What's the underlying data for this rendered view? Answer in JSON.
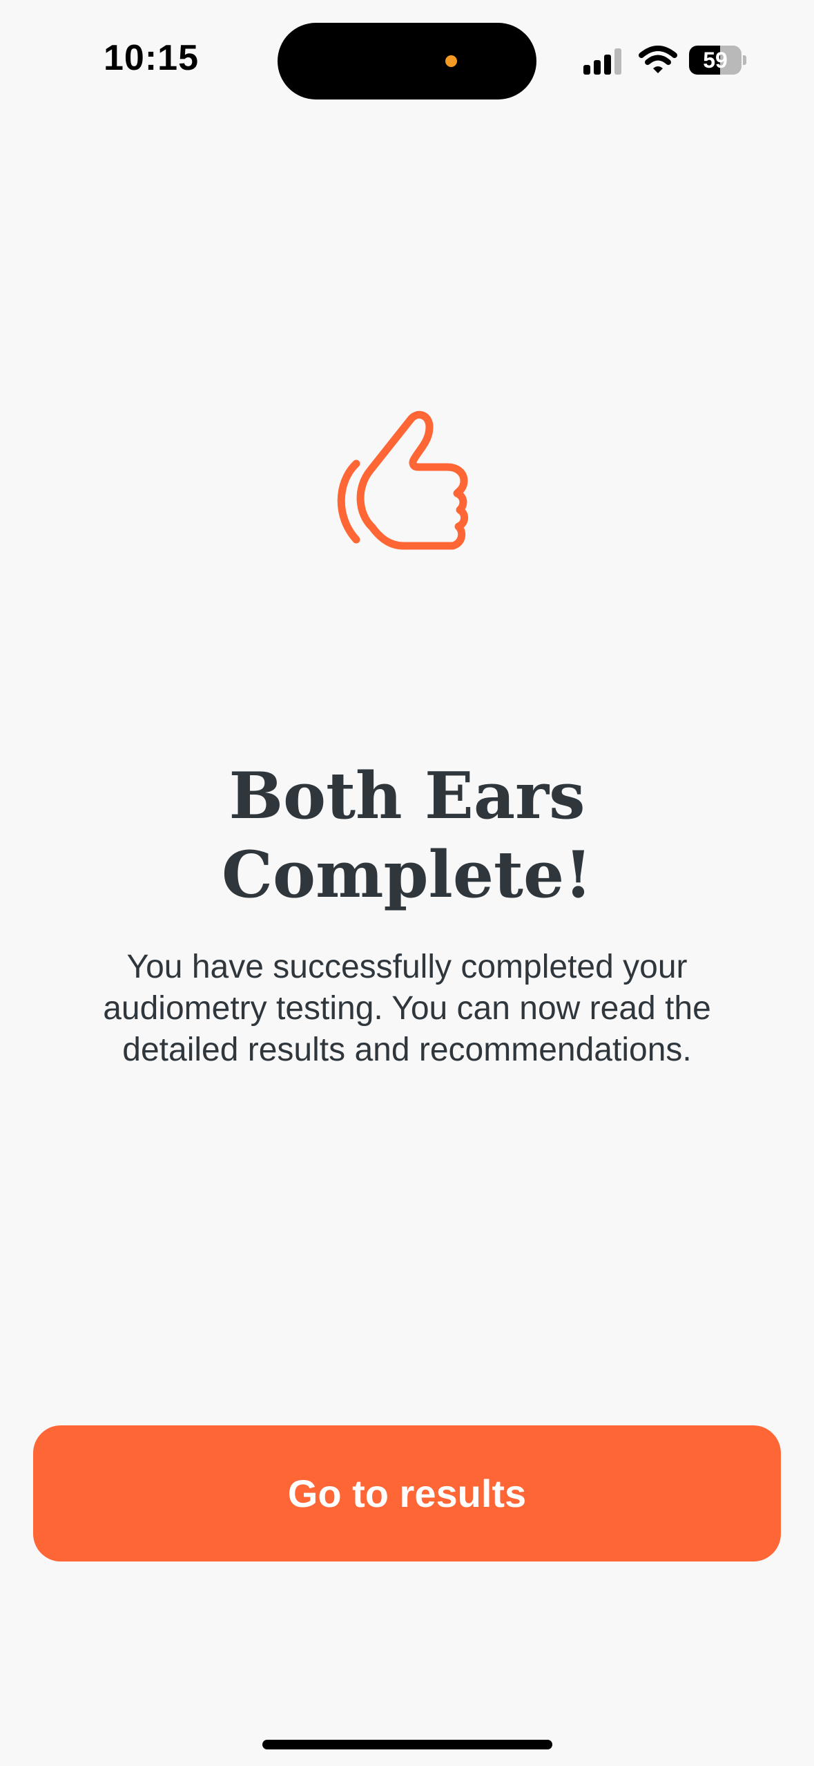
{
  "status_bar": {
    "time": "10:15",
    "battery_level": "59",
    "battery_fraction": 0.59,
    "icons": [
      "cellular-signal-icon",
      "wifi-icon",
      "battery-icon"
    ],
    "recording_dot_color": "#f59a23"
  },
  "main": {
    "icon": "thumbs-up-icon",
    "icon_color": "#ff6635",
    "title": "Both Ears Complete!",
    "description": "You have successfully completed your audiometry testing. You can now read the detailed results and recommendations."
  },
  "footer": {
    "primary_button_label": "Go to results",
    "primary_button_color": "#ff6635"
  },
  "colors": {
    "background": "#f8f8f8",
    "text": "#2f363c",
    "accent": "#ff6635"
  }
}
